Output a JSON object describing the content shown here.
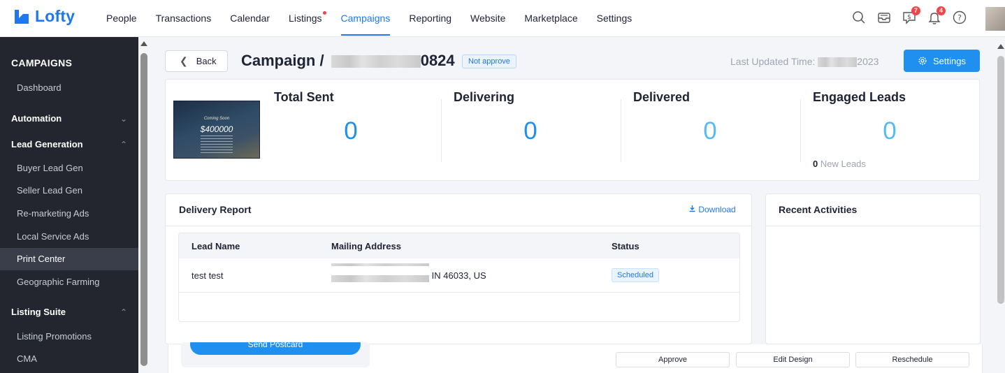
{
  "brand": {
    "name": "Lofty",
    "accent": "#1f78f0"
  },
  "nav": {
    "items": [
      {
        "label": "People"
      },
      {
        "label": "Transactions"
      },
      {
        "label": "Calendar"
      },
      {
        "label": "Listings"
      },
      {
        "label": "Campaigns"
      },
      {
        "label": "Reporting"
      },
      {
        "label": "Website"
      },
      {
        "label": "Marketplace"
      },
      {
        "label": "Settings"
      }
    ],
    "active": "Campaigns",
    "icons": [
      "search-icon",
      "inbox-icon",
      "dollar-chat-icon",
      "bell-icon",
      "help-icon"
    ],
    "badges": {
      "dollar_chat": "7",
      "bell": "4"
    }
  },
  "sidebar": {
    "title": "CAMPAIGNS",
    "dashboard": "Dashboard",
    "automation": "Automation",
    "lead_generation": "Lead Generation",
    "lead_items": [
      "Buyer Lead Gen",
      "Seller Lead Gen",
      "Re-marketing Ads",
      "Local Service Ads",
      "Print Center",
      "Geographic Farming"
    ],
    "active_item": "Print Center",
    "listing_suite": "Listing Suite",
    "listing_items": [
      "Listing Promotions",
      "CMA"
    ]
  },
  "header": {
    "back_label": "Back",
    "title_prefix": "Campaign /",
    "title_suffix": "0824",
    "status": "Not approve",
    "updated_label": "Last Updated Time:",
    "updated_suffix": "2023",
    "settings_label": "Settings"
  },
  "stats": {
    "postcard": {
      "coming": "Coming Soon",
      "price": "$400000"
    },
    "total_sent": {
      "label": "Total Sent",
      "value": "0"
    },
    "delivering": {
      "label": "Delivering",
      "value": "0"
    },
    "delivered": {
      "label": "Delivered",
      "value": "0"
    },
    "engaged": {
      "label": "Engaged Leads",
      "value": "0",
      "new_count": "0",
      "new_label": "New Leads"
    }
  },
  "report": {
    "title": "Delivery Report",
    "download_label": "Download",
    "columns": [
      "Lead Name",
      "Mailing Address",
      "Status"
    ],
    "rows": [
      {
        "name": "test test",
        "address_suffix": "IN 46033, US",
        "status": "Scheduled"
      }
    ]
  },
  "activities": {
    "title": "Recent Activities"
  },
  "bottom": {
    "send_label": "Send Postcard",
    "approve_label": "Approve",
    "edit_label": "Edit Design",
    "reschedule_label": "Reschedule"
  }
}
